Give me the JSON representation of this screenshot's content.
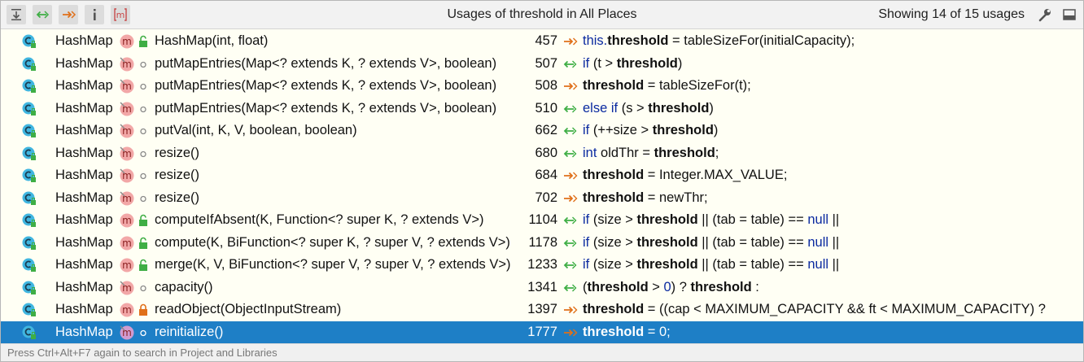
{
  "header": {
    "title": "Usages of threshold in All Places",
    "count": "Showing 14 of 15 usages",
    "m_badge": "m"
  },
  "colors": {
    "selection": "#1e7fc6",
    "class_icon": "#40b6e0",
    "method_icon": "#f2a7a7",
    "write_arrow": "#e0701a",
    "read_arrow": "#3fae45",
    "keyword": "#0b2aa0"
  },
  "icons": {
    "class": "class-icon",
    "method": "method-icon",
    "public": "unlocked-icon",
    "private": "lock-icon",
    "package": "circle-icon",
    "write": "write-access-arrow-icon",
    "read": "read-access-arrow-icon"
  },
  "usages": [
    {
      "cls": "HashMap",
      "method": "HashMap(int, float)",
      "line": "457",
      "access": "write",
      "vis": "public",
      "code": [
        "this.",
        "threshold",
        " = tableSizeFor(initialCapacity);"
      ]
    },
    {
      "cls": "HashMap",
      "method": "putMapEntries(Map<? extends K, ? extends V>, boolean)",
      "line": "507",
      "access": "read",
      "vis": "package",
      "code": [
        "if",
        " (t > ",
        "threshold",
        ")"
      ]
    },
    {
      "cls": "HashMap",
      "method": "putMapEntries(Map<? extends K, ? extends V>, boolean)",
      "line": "508",
      "access": "write",
      "vis": "package",
      "code": [
        "threshold",
        " = tableSizeFor(t);"
      ]
    },
    {
      "cls": "HashMap",
      "method": "putMapEntries(Map<? extends K, ? extends V>, boolean)",
      "line": "510",
      "access": "read",
      "vis": "package",
      "code": [
        "else if",
        " (s > ",
        "threshold",
        ")"
      ]
    },
    {
      "cls": "HashMap",
      "method": "putVal(int, K, V, boolean, boolean)",
      "line": "662",
      "access": "read",
      "vis": "package",
      "code": [
        "if",
        " (++size > ",
        "threshold",
        ")"
      ]
    },
    {
      "cls": "HashMap",
      "method": "resize()",
      "line": "680",
      "access": "read",
      "vis": "package",
      "code": [
        "int",
        " oldThr = ",
        "threshold",
        ";"
      ]
    },
    {
      "cls": "HashMap",
      "method": "resize()",
      "line": "684",
      "access": "write",
      "vis": "package",
      "code": [
        "threshold",
        " = Integer.MAX_VALUE;"
      ]
    },
    {
      "cls": "HashMap",
      "method": "resize()",
      "line": "702",
      "access": "write",
      "vis": "package",
      "code": [
        "threshold",
        " = newThr;"
      ]
    },
    {
      "cls": "HashMap",
      "method": "computeIfAbsent(K, Function<? super K, ? extends V>)",
      "line": "1104",
      "access": "read",
      "vis": "public",
      "code": [
        "if",
        " (size > ",
        "threshold",
        " || (tab = table) == ",
        "null",
        " ||"
      ]
    },
    {
      "cls": "HashMap",
      "method": "compute(K, BiFunction<? super K, ? super V, ? extends V>)",
      "line": "1178",
      "access": "read",
      "vis": "public",
      "code": [
        "if",
        " (size > ",
        "threshold",
        " || (tab = table) == ",
        "null",
        " ||"
      ]
    },
    {
      "cls": "HashMap",
      "method": "merge(K, V, BiFunction<? super V, ? super V, ? extends V>)",
      "line": "1233",
      "access": "read",
      "vis": "public",
      "code": [
        "if",
        " (size > ",
        "threshold",
        " || (tab = table) == ",
        "null",
        " ||"
      ]
    },
    {
      "cls": "HashMap",
      "method": "capacity()",
      "line": "1341",
      "access": "read",
      "vis": "package",
      "code": [
        "(",
        "threshold",
        " > ",
        "0",
        ") ? ",
        "threshold",
        " :"
      ]
    },
    {
      "cls": "HashMap",
      "method": "readObject(ObjectInputStream)",
      "line": "1397",
      "access": "write",
      "vis": "private",
      "code": [
        "threshold",
        " = ((cap < MAXIMUM_CAPACITY && ft < MAXIMUM_CAPACITY) ?"
      ]
    },
    {
      "cls": "HashMap",
      "method": "reinitialize()",
      "line": "1777",
      "access": "write",
      "vis": "package",
      "selected": true,
      "code": [
        "threshold",
        " = ",
        "0",
        ";"
      ]
    }
  ],
  "footer": "Press Ctrl+Alt+F7 again to search in Project and Libraries"
}
